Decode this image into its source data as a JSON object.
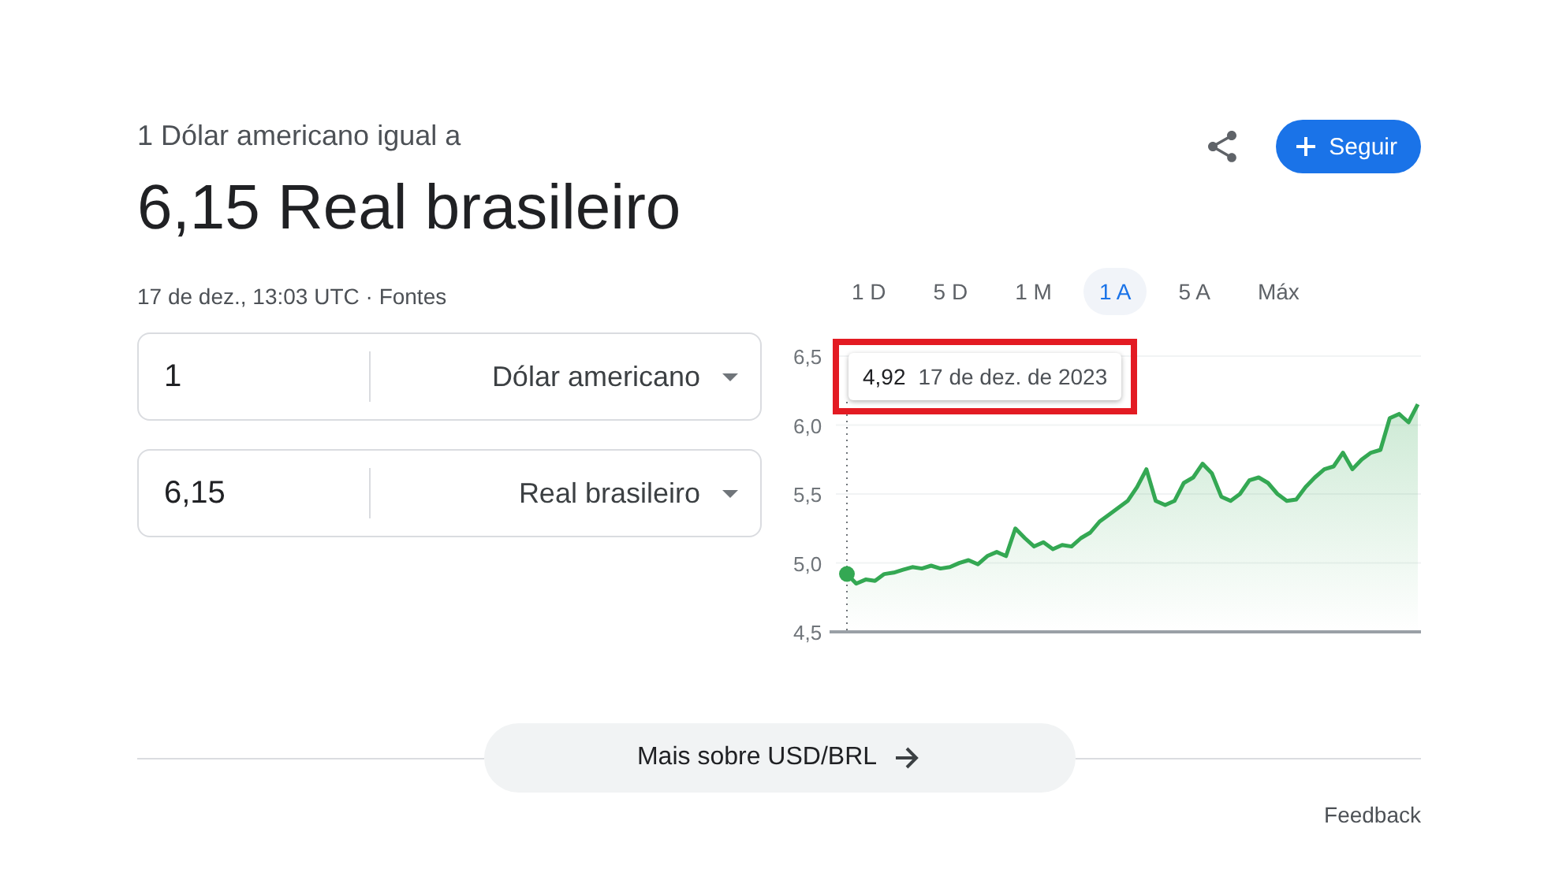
{
  "header": {
    "subtitle": "1 Dólar americano igual a",
    "result": "6,15 Real brasileiro",
    "meta": "17 de dez., 13:03 UTC · ",
    "sources_link": "Fontes",
    "follow_button": "Seguir"
  },
  "converter": [
    {
      "value": "1",
      "currency": "Dólar americano"
    },
    {
      "value": "6,15",
      "currency": "Real brasileiro"
    }
  ],
  "ranges": [
    {
      "label": "1 D",
      "selected": false
    },
    {
      "label": "5 D",
      "selected": false
    },
    {
      "label": "1 M",
      "selected": false
    },
    {
      "label": "1 A",
      "selected": true
    },
    {
      "label": "5 A",
      "selected": false
    },
    {
      "label": "Máx",
      "selected": false
    }
  ],
  "tooltip": {
    "value": "4,92",
    "date": "17 de dez. de 2023",
    "highlighted": true
  },
  "chart_data": {
    "type": "area",
    "ylim": [
      4.5,
      6.5
    ],
    "yticks": [
      {
        "value": 4.5,
        "label": "4,5"
      },
      {
        "value": 5,
        "label": "5,0"
      },
      {
        "value": 5.5,
        "label": "5,5"
      },
      {
        "value": 6,
        "label": "6,0"
      },
      {
        "value": 6.5,
        "label": "6,5"
      }
    ],
    "grid": true,
    "series": [
      {
        "color": "#34a853",
        "values": [
          4.92,
          4.85,
          4.88,
          4.87,
          4.92,
          4.93,
          4.95,
          4.97,
          4.96,
          4.98,
          4.96,
          4.97,
          5.0,
          5.02,
          4.99,
          5.05,
          5.08,
          5.05,
          5.25,
          5.18,
          5.12,
          5.15,
          5.1,
          5.13,
          5.12,
          5.18,
          5.22,
          5.3,
          5.35,
          5.4,
          5.45,
          5.55,
          5.68,
          5.45,
          5.42,
          5.45,
          5.58,
          5.62,
          5.72,
          5.65,
          5.48,
          5.45,
          5.5,
          5.6,
          5.62,
          5.58,
          5.5,
          5.45,
          5.46,
          5.55,
          5.62,
          5.68,
          5.7,
          5.8,
          5.68,
          5.75,
          5.8,
          5.82,
          6.05,
          6.08,
          6.02,
          6.15
        ]
      }
    ]
  },
  "more_button": "Mais sobre USD/BRL",
  "feedback": "Feedback"
}
